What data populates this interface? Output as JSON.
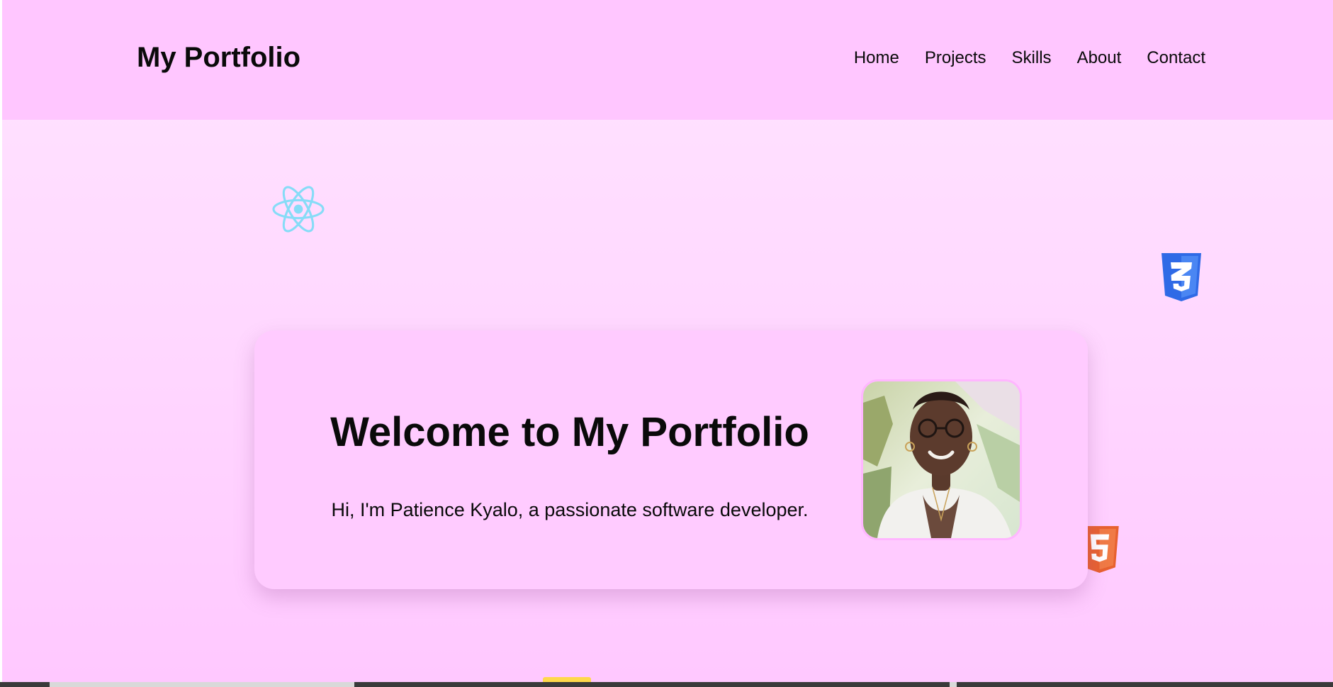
{
  "header": {
    "logo": "My Portfolio",
    "nav": [
      "Home",
      "Projects",
      "Skills",
      "About",
      "Contact"
    ]
  },
  "hero": {
    "title": "Welcome to My Portfolio",
    "subtitle": "Hi, I'm Patience Kyalo, a passionate software developer."
  },
  "icons": {
    "react": "react-logo-icon",
    "css": "css3-logo-icon",
    "html": "html5-logo-icon"
  },
  "colors": {
    "header_bg": "#ffc6ff",
    "page_bg_top": "#ffe4ff",
    "card_bg": "#ffcbff",
    "react": "#61dafb",
    "css": "#2965f1",
    "html": "#e44d26"
  }
}
